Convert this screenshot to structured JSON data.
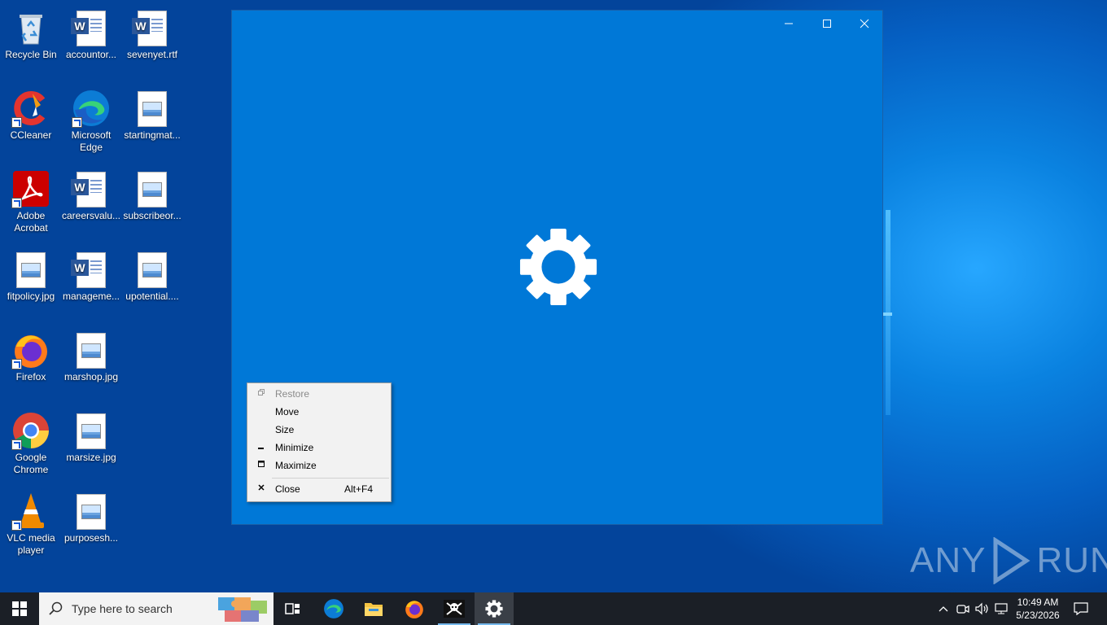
{
  "desktop": {
    "icons": [
      {
        "label": "Recycle Bin"
      },
      {
        "label": "accountor..."
      },
      {
        "label": "sevenyet.rtf"
      },
      {
        "label": "CCleaner"
      },
      {
        "label": "Microsoft Edge"
      },
      {
        "label": "startingmat..."
      },
      {
        "label": "Adobe Acrobat"
      },
      {
        "label": "careersvalu..."
      },
      {
        "label": "subscribeor..."
      },
      {
        "label": "fitpolicy.jpg"
      },
      {
        "label": "manageme..."
      },
      {
        "label": "upotential...."
      },
      {
        "label": "Firefox"
      },
      {
        "label": "marshop.jpg"
      },
      {
        "label": "Google Chrome"
      },
      {
        "label": "marsize.jpg"
      },
      {
        "label": "VLC media player"
      },
      {
        "label": "purposesh..."
      }
    ]
  },
  "window": {
    "icon": "gear-icon",
    "background": "#0078d7"
  },
  "context_menu": {
    "items": [
      {
        "label": "Restore",
        "glyph": "restore-icon",
        "enabled": false
      },
      {
        "label": "Move",
        "enabled": true
      },
      {
        "label": "Size",
        "enabled": true
      },
      {
        "label": "Minimize",
        "glyph": "minimize-icon",
        "enabled": true
      },
      {
        "label": "Maximize",
        "glyph": "maximize-icon",
        "enabled": true
      },
      {
        "label": "Close",
        "glyph": "close-icon",
        "accelerator": "Alt+F4",
        "enabled": true
      }
    ]
  },
  "watermark": {
    "left": "ANY",
    "right": "RUN"
  },
  "taskbar": {
    "search_placeholder": "Type here to search",
    "apps": [
      "task-view-icon",
      "edge-icon",
      "file-explorer-icon",
      "firefox-icon",
      "pirate-app-icon",
      "settings-icon"
    ],
    "clock": {
      "time": "10:49 AM",
      "date": "5/23/2026"
    }
  }
}
